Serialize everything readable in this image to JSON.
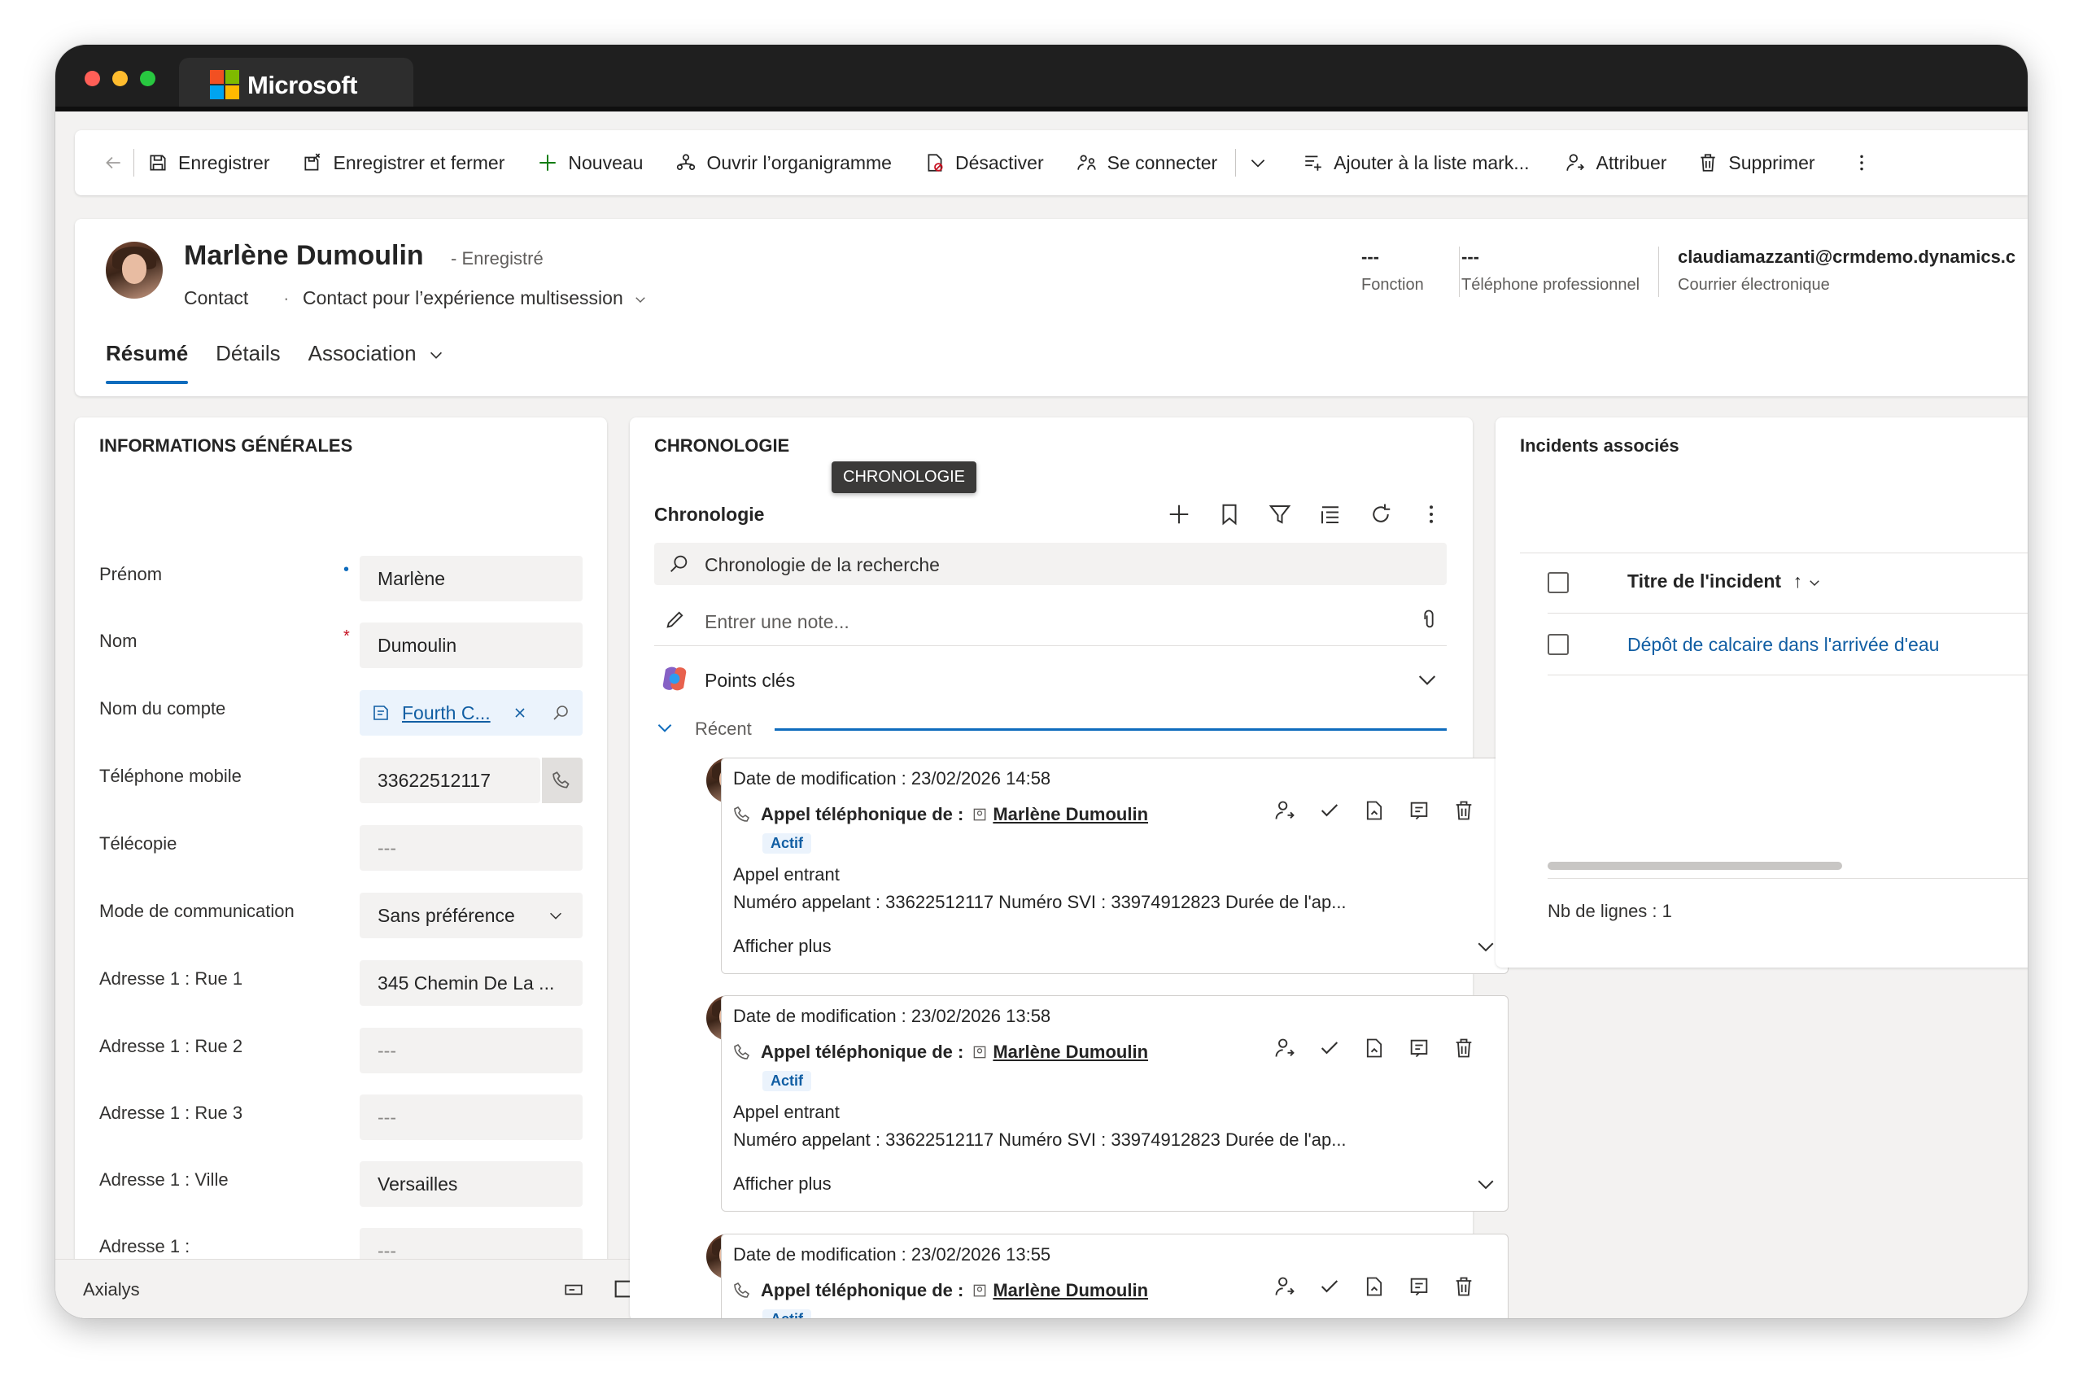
{
  "window": {
    "tab_title": "Microsoft",
    "brand_colors": {
      "red": "#f25022",
      "green": "#7fba00",
      "blue": "#00a4ef",
      "yellow": "#ffb900"
    }
  },
  "toolbar": {
    "back_icon": "back-arrow-icon",
    "save": "Enregistrer",
    "save_close": "Enregistrer et fermer",
    "new": "Nouveau",
    "org_chart": "Ouvrir l’organigramme",
    "deactivate": "Désactiver",
    "connect": "Se connecter",
    "add_to_list": "Ajouter à la liste mark...",
    "assign": "Attribuer",
    "delete": "Supprimer"
  },
  "header": {
    "name": "Marlène Dumoulin",
    "status": "- Enregistré",
    "entity": "Contact",
    "separator": "·",
    "form": "Contact pour l’expérience multisession",
    "fields": [
      {
        "value": "---",
        "label": "Fonction"
      },
      {
        "value": "---",
        "label": "Téléphone professionnel"
      },
      {
        "value": "claudiamazzanti@crmdemo.dynamics.c",
        "label": "Courrier électronique"
      }
    ],
    "tabs": [
      {
        "label": "Résumé",
        "active": true
      },
      {
        "label": "Détails",
        "active": false
      },
      {
        "label": "Association",
        "active": false
      }
    ]
  },
  "general": {
    "title": "INFORMATIONS GÉNÉRALES",
    "required_mark": "*",
    "recommended_mark": "•",
    "fields": [
      {
        "label": "Prénom",
        "value": "Marlène"
      },
      {
        "label": "Nom",
        "value": "Dumoulin"
      },
      {
        "label": "Nom du compte",
        "value": "Fourth C..."
      },
      {
        "label": "Téléphone mobile",
        "value": "33622512117"
      },
      {
        "label": "Télécopie",
        "value": "---"
      },
      {
        "label": "Mode de communication",
        "value": "Sans préférence"
      },
      {
        "label": "Adresse 1 : Rue 1",
        "value": "345 Chemin De La ..."
      },
      {
        "label": "Adresse 1 : Rue 2",
        "value": "---"
      },
      {
        "label": "Adresse 1 : Rue 3",
        "value": "---"
      },
      {
        "label": "Adresse 1 : Ville",
        "value": "Versailles"
      },
      {
        "label": "Adresse 1 :",
        "value": "---"
      }
    ],
    "bottom_bar_label": "Axialys"
  },
  "timeline": {
    "section_title": "CHRONOLOGIE",
    "tooltip": "CHRONOLOGIE",
    "title": "Chronologie",
    "search_placeholder": "Chronologie de la recherche",
    "note_placeholder": "Entrer une note...",
    "key_points": "Points clés",
    "recent": "Récent",
    "activities": [
      {
        "date": "Date de modification : 23/02/2026 14:58",
        "subject_prefix": "Appel téléphonique de :",
        "contact": "Marlène Dumoulin",
        "badge": "Actif",
        "line1": "Appel entrant",
        "line2": "Numéro appelant : 33622512117 Numéro SVI : 33974912823 Durée de l'ap...",
        "more": "Afficher plus"
      },
      {
        "date": "Date de modification : 23/02/2026 13:58",
        "subject_prefix": "Appel téléphonique de :",
        "contact": "Marlène Dumoulin",
        "badge": "Actif",
        "line1": "Appel entrant",
        "line2": "Numéro appelant : 33622512117 Numéro SVI : 33974912823 Durée de l'ap...",
        "more": "Afficher plus"
      },
      {
        "date": "Date de modification : 23/02/2026 13:55",
        "subject_prefix": "Appel téléphonique de :",
        "contact": "Marlène Dumoulin",
        "badge": "Actif"
      }
    ]
  },
  "incidents": {
    "title": "Incidents associés",
    "column": "Titre de l'incident",
    "sort_indicator": "↑",
    "rows": [
      {
        "title": "Dépôt de calcaire dans l'arrivée d'eau"
      }
    ],
    "row_count": "Nb de lignes : 1",
    "link_color": "#115ea3"
  }
}
